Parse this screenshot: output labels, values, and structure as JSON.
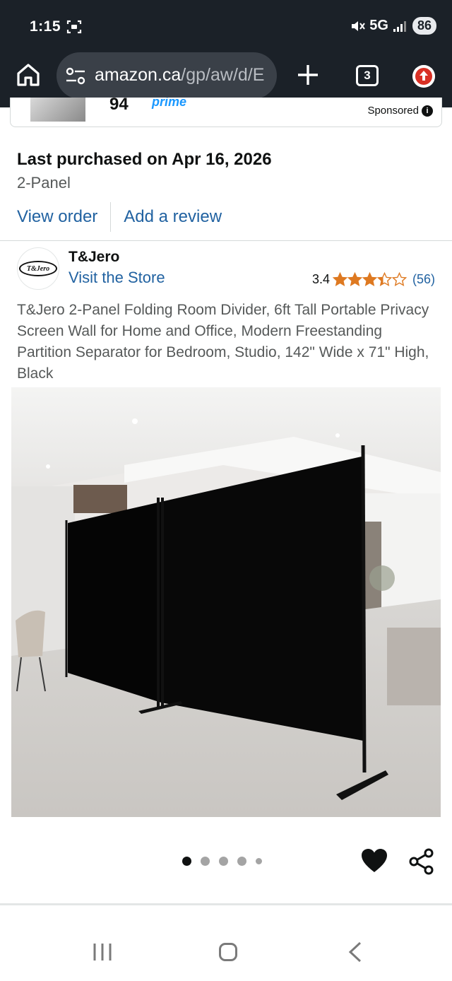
{
  "status_bar": {
    "time": "1:15",
    "network": "5G",
    "battery": "86"
  },
  "browser": {
    "url_host": "amazon.ca",
    "url_path": "/gp/aw/d/E",
    "tab_count": "3"
  },
  "sponsored": {
    "price_fragment": "94",
    "prime_label": "prime",
    "label": "Sponsored"
  },
  "purchase": {
    "title": "Last purchased on Apr 16, 2026",
    "variant": "2-Panel",
    "view_order_label": "View order",
    "add_review_label": "Add a review"
  },
  "brand": {
    "logo_text": "T&Jero",
    "name": "T&Jero",
    "store_link": "Visit the Store"
  },
  "rating": {
    "value": "3.4",
    "stars": 3.4,
    "count": "(56)"
  },
  "product": {
    "title": "T&Jero 2-Panel Folding Room Divider, 6ft Tall Portable Privacy Screen Wall for Home and Office, Modern Freestanding Partition Separator for Bedroom, Studio, 142\" Wide x 71\" High, Black"
  },
  "carousel": {
    "total_dots": 5,
    "active_index": 0
  },
  "colors": {
    "chrome_bg": "#1b2128",
    "link": "#2162a1",
    "star": "#de7921",
    "text_primary": "#0f1111",
    "text_secondary": "#565959"
  }
}
